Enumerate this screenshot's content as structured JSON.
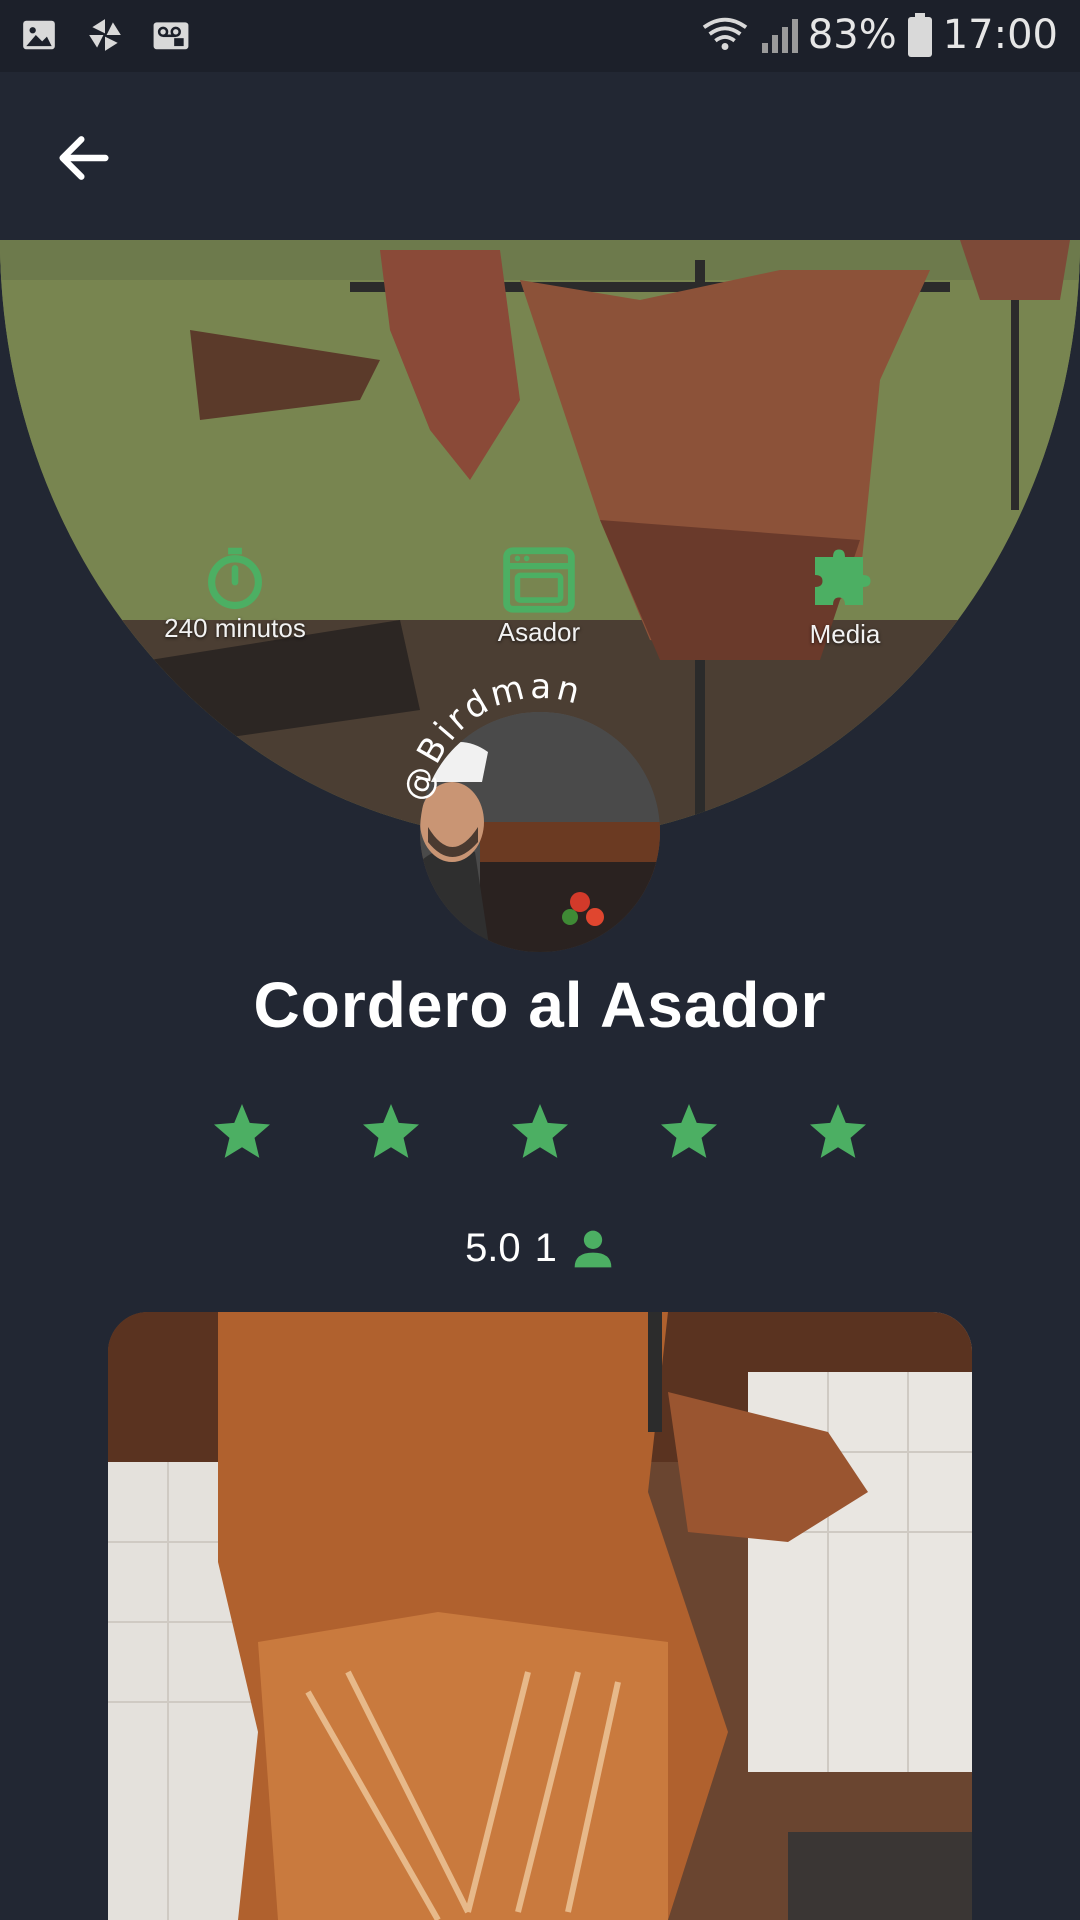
{
  "status_bar": {
    "left_icons": [
      "image-icon",
      "pinwheel-icon",
      "voicemail-icon"
    ],
    "battery_percent": "83%",
    "time": "17:00"
  },
  "app_bar": {
    "back_icon": "arrow-left-icon"
  },
  "hero": {
    "stats": [
      {
        "icon": "timer-icon",
        "label": "240 minutos"
      },
      {
        "icon": "oven-icon",
        "label": "Asador"
      },
      {
        "icon": "puzzle-icon",
        "label": "Media"
      }
    ]
  },
  "author": {
    "username": "@Birdman"
  },
  "recipe": {
    "title": "Cordero al Asador",
    "stars": 5,
    "rating": "5.0",
    "reviews": "1"
  },
  "colors": {
    "accent": "#4CAF63",
    "background": "#222733"
  }
}
